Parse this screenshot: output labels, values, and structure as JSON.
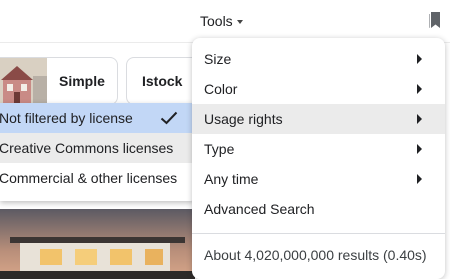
{
  "header": {
    "tools_label": "Tools",
    "bookmark_icon": "bookmark-icon"
  },
  "chips": [
    {
      "label": "Simple",
      "thumb": "house-thumbnail"
    },
    {
      "label": "Istock"
    }
  ],
  "license_menu": {
    "items": [
      {
        "label": "Not filtered by license",
        "selected": true
      },
      {
        "label": "Creative Commons licenses",
        "hovered": true
      },
      {
        "label": "Commercial & other licenses"
      }
    ]
  },
  "tools_menu": {
    "items": [
      {
        "label": "Size",
        "has_submenu": true
      },
      {
        "label": "Color",
        "has_submenu": true
      },
      {
        "label": "Usage rights",
        "has_submenu": true,
        "active": true
      },
      {
        "label": "Type",
        "has_submenu": true
      },
      {
        "label": "Any time",
        "has_submenu": true
      },
      {
        "label": "Advanced Search",
        "has_submenu": false
      }
    ],
    "results_stats": "About 4,020,000,000 results (0.40s)"
  },
  "colors": {
    "selected_bg": "#c2d7f6",
    "hover_bg": "#ebebeb",
    "text": "#202124"
  }
}
